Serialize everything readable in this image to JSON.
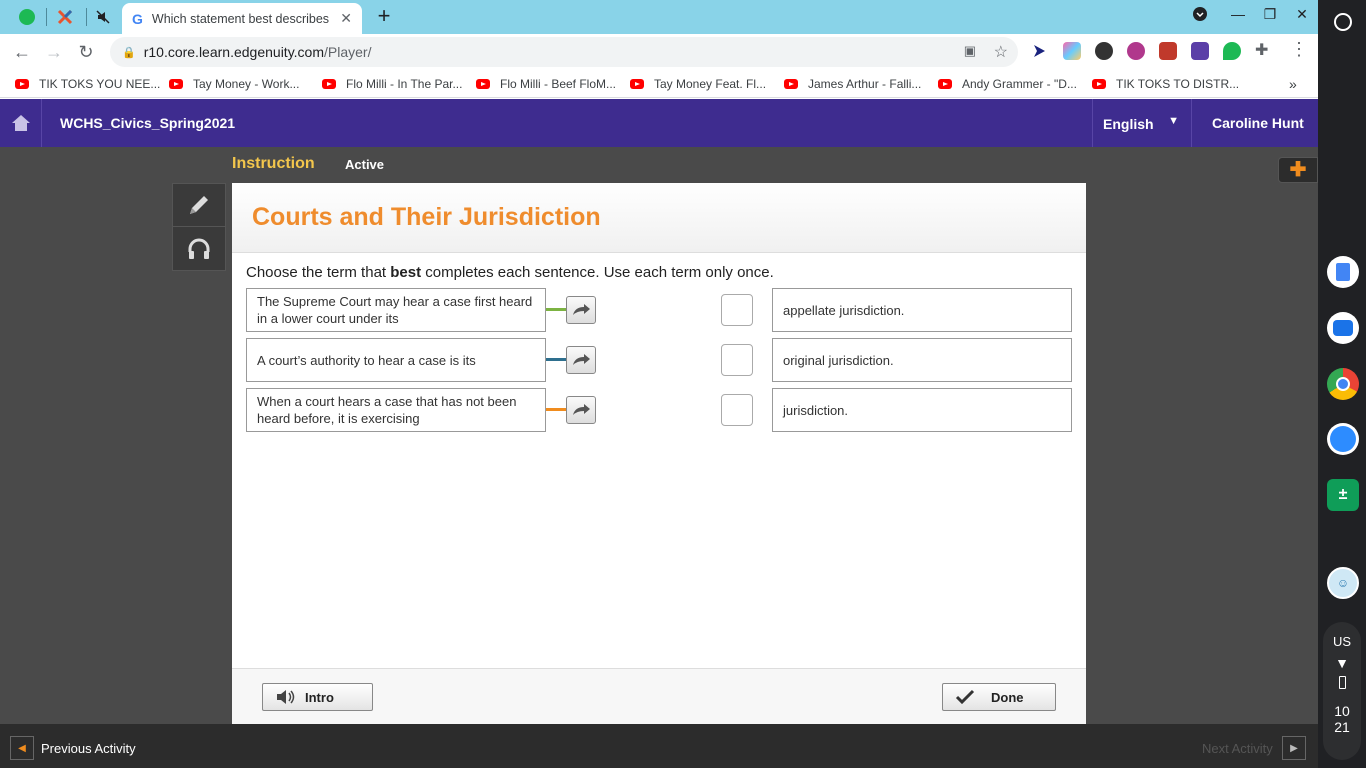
{
  "browser": {
    "active_tab_title": "Which statement best describes",
    "url_host": "r10.core.learn.edgenuity.com",
    "url_path": "/Player/",
    "bookmarks": [
      "TIK TOKS YOU NEE...",
      "Tay Money - Work...",
      "Flo Milli - In The Par...",
      "Flo Milli - Beef FloM...",
      "Tay Money Feat. Fl...",
      "James Arthur - Falli...",
      "Andy Grammer - \"D...",
      "TIK TOKS TO DISTR..."
    ]
  },
  "header": {
    "course": "WCHS_Civics_Spring2021",
    "language": "English",
    "user": "Caroline Hunt"
  },
  "subheader": {
    "section": "Instruction",
    "status": "Active"
  },
  "activity": {
    "title": "Courts and Their Jurisdiction",
    "prompt_pre": "Choose the term that ",
    "prompt_bold": "best",
    "prompt_post": " completes each sentence. Use each term only once.",
    "stems": [
      {
        "text": "The Supreme Court may hear a case first heard in a lower court under its",
        "color": "#7cb342"
      },
      {
        "text": "A court’s authority to hear a case is its",
        "color": "#2e6f8e"
      },
      {
        "text": "When a court hears a case that has not been heard before, it is exercising",
        "color": "#f08c1e"
      }
    ],
    "options": [
      "appellate jurisdiction.",
      "original jurisdiction.",
      "jurisdiction."
    ],
    "intro_label": "Intro",
    "done_label": "Done"
  },
  "bottom_nav": {
    "prev_label": "Previous Activity",
    "next_label": "Next Activity"
  },
  "shelf": {
    "locale": "US",
    "time_hour": "10",
    "time_min": "21"
  },
  "colors": {
    "header_bg": "#3e2c8f",
    "title_orange": "#ef8c2d",
    "tab_strip": "#89d3e8"
  }
}
